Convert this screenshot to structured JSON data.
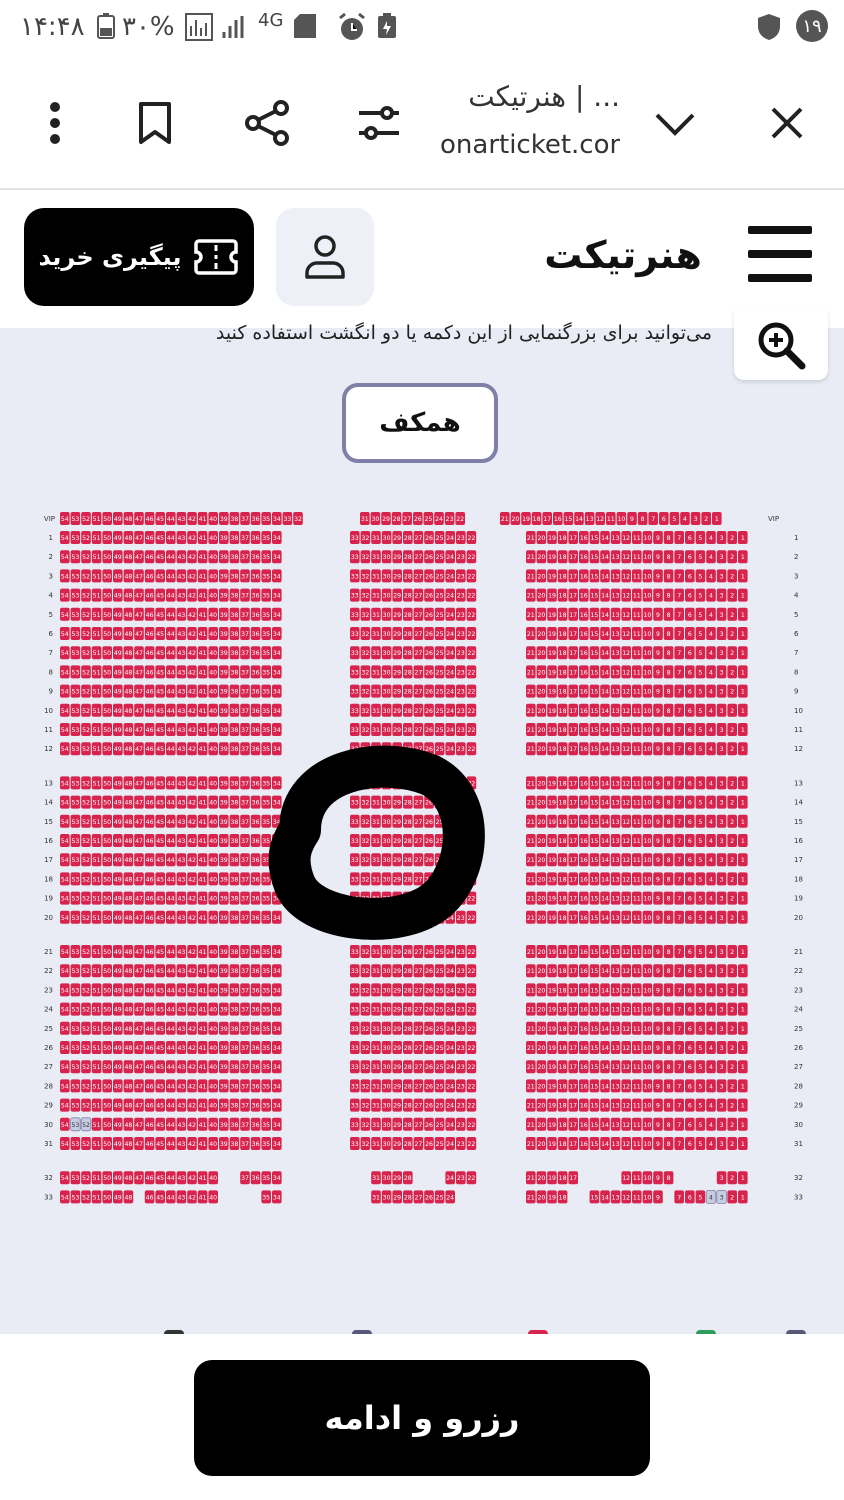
{
  "status_bar": {
    "time": "۱۴:۴۸",
    "battery": "۳۰%",
    "network": "4G",
    "notification_count": "۱۹"
  },
  "browser": {
    "tab_title": "هنرتیکت | ...",
    "url": "onarticket.com"
  },
  "header": {
    "logo_text": "هنرتیکت",
    "track_button": "پیگیری خرید"
  },
  "hint": "می‌توانید برای بزرگنمایی از این دکمه یا دو انگشت استفاده کنید",
  "stage_label": "همکف",
  "seating": {
    "vip_row_label": "VIP",
    "row_count": 33,
    "row_breaks_after": [
      12,
      20,
      31
    ],
    "left_section_seats": [
      34,
      54
    ],
    "center_section_seats": [
      22,
      33
    ],
    "right_section_seats": [
      1,
      21
    ],
    "vip_row": {
      "left": [
        32,
        54
      ],
      "center": [
        22,
        31
      ],
      "right": [
        1,
        21
      ]
    },
    "seat_color": "#d8234c",
    "selected_color": "#c7cde0",
    "selected_seats": [
      {
        "row": 30,
        "seats": [
          53,
          52
        ]
      },
      {
        "row": 33,
        "seats": [
          4,
          3
        ]
      }
    ],
    "row32": {
      "left": [
        [
          40,
          54
        ],
        [
          34,
          37
        ]
      ],
      "center": [
        [
          28,
          31
        ],
        [
          22,
          24
        ]
      ],
      "right": [
        [
          17,
          21
        ],
        [
          8,
          12
        ],
        [
          1,
          3
        ]
      ]
    },
    "row33": {
      "left": [
        [
          48,
          54
        ],
        [
          40,
          46
        ],
        [
          34,
          35
        ]
      ],
      "center": [
        [
          24,
          31
        ]
      ],
      "right": [
        [
          18,
          21
        ],
        [
          9,
          15
        ],
        [
          1,
          7
        ]
      ]
    }
  },
  "annotation": {
    "type": "hand-drawn circle",
    "color": "#000000"
  },
  "reserve_button": "رزرو و ادامه"
}
